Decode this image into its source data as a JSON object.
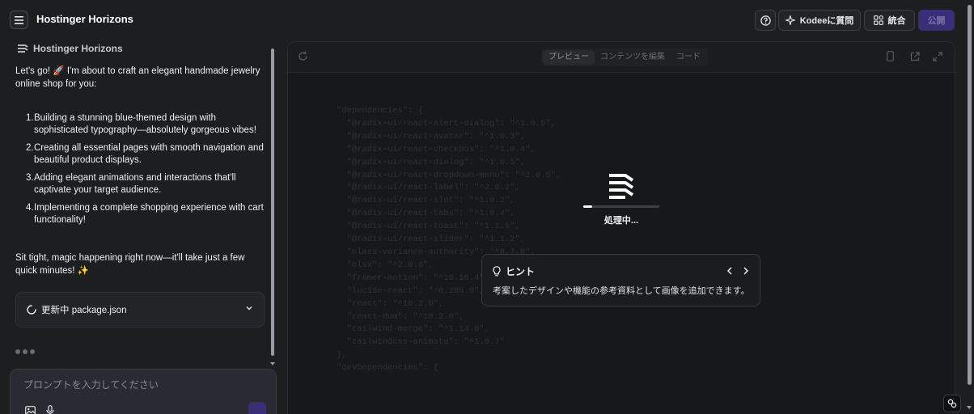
{
  "header": {
    "app_title": "Hostinger Horizons",
    "kodee_label": "Kodeeに質問",
    "integration_label": "統合",
    "publish_label": "公開"
  },
  "chat": {
    "brand": "Hostinger Horizons",
    "intro": "Let's go! 🚀 I'm about to craft an elegant handmade jewelry online shop for you:",
    "steps": [
      {
        "num": "1.",
        "text": "Building a stunning blue-themed design with sophisticated typography—absolutely gorgeous vibes!"
      },
      {
        "num": "2.",
        "text": "Creating all essential pages with smooth navigation and beautiful product displays."
      },
      {
        "num": "3.",
        "text": "Adding elegant animations and interactions that'll captivate your target audience."
      },
      {
        "num": "4.",
        "text": "Implementing a complete shopping experience with cart functionality!"
      }
    ],
    "outro": "Sit tight, magic happening right now—it'll take just a few quick minutes! ✨",
    "update_status": "更新中 package.json",
    "prompt_placeholder": "プロンプトを入力してください"
  },
  "preview": {
    "tabs": [
      {
        "label": "プレビュー",
        "active": true
      },
      {
        "label": "コンテンツを編集",
        "active": false
      },
      {
        "label": "コード",
        "active": false
      }
    ],
    "loader_label": "処理中...",
    "progress": 0.12,
    "code_lines": [
      "\"dependencies\": {",
      "  \"@radix-ui/react-alert-dialog\": \"^1.0.5\",",
      "  \"@radix-ui/react-avatar\": \"^1.0.3\",",
      "  \"@radix-ui/react-checkbox\": \"^1.0.4\",",
      "  \"@radix-ui/react-dialog\": \"^1.0.5\",",
      "  \"@radix-ui/react-dropdown-menu\": \"^2.0.5\",",
      "  \"@radix-ui/react-label\": \"^2.0.2\",",
      "  \"@radix-ui/react-slot\": \"^1.0.2\",",
      "  \"@radix-ui/react-tabs\": \"^1.0.4\",",
      "  \"@radix-ui/react-toast\": \"^1.1.5\",",
      "  \"@radix-ui/react-slider\": \"^1.1.2\",",
      "  \"class-variance-authority\": \"^0.7.0\",",
      "  \"clsx\": \"^2.0.0\",",
      "  \"framer-motion\": \"^10.16.4\",",
      "  \"lucide-react\": \"^0.285.0\",",
      "  \"react\": \"^18.2.0\",",
      "  \"react-dom\": \"^18.2.0\",",
      "  \"tailwind-merge\": \"^1.14.0\",",
      "  \"tailwindcss-animate\": \"^1.0.7\"",
      "},",
      "\"devDependencies\": {"
    ]
  },
  "hint": {
    "title": "ヒント",
    "body": "考案したデザインや機能の参考資料として画像を追加できます。"
  },
  "colors": {
    "background": "#1d1e20",
    "accent": "#3b2e78",
    "text": "#f0f0f2"
  }
}
